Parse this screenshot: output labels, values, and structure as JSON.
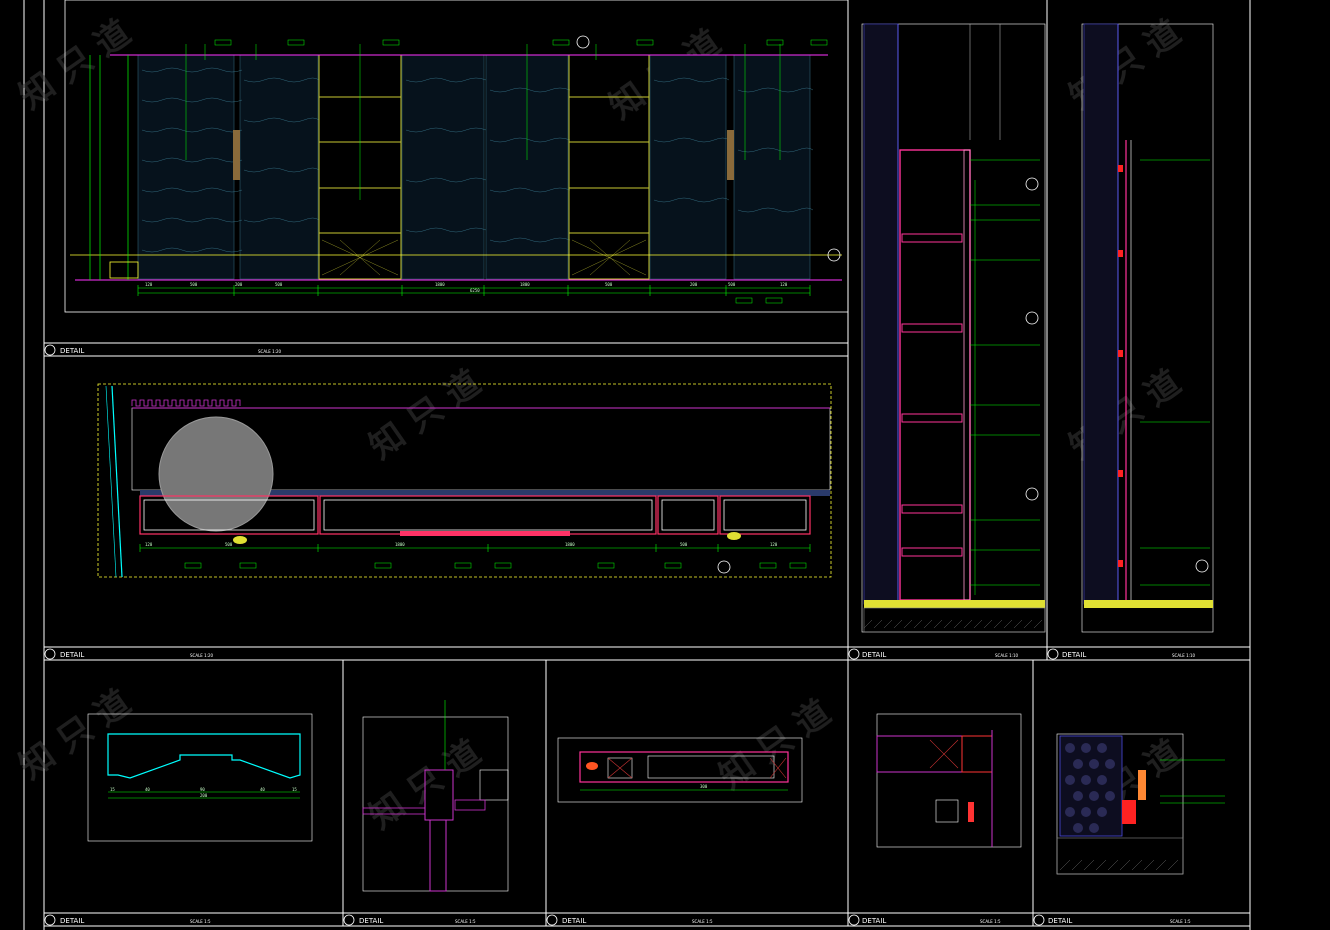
{
  "title_blocks": [
    {
      "id": "elev-main",
      "label": "DETAIL",
      "name": "",
      "scale": "SCALE 1:20"
    },
    {
      "id": "plan-main",
      "label": "DETAIL",
      "name": "",
      "scale": "SCALE 1:20"
    },
    {
      "id": "section-1",
      "label": "DETAIL",
      "name": "",
      "scale": "SCALE 1:10"
    },
    {
      "id": "section-2",
      "label": "DETAIL",
      "name": "",
      "scale": "SCALE 1:10"
    },
    {
      "id": "detail-1",
      "label": "DETAIL",
      "name": "",
      "scale": "SCALE 1:5"
    },
    {
      "id": "detail-2",
      "label": "DETAIL",
      "name": "",
      "scale": "SCALE 1:5"
    },
    {
      "id": "detail-3",
      "label": "DETAIL",
      "name": "",
      "scale": "SCALE 1:5"
    },
    {
      "id": "detail-4",
      "label": "DETAIL",
      "name": "",
      "scale": "SCALE 1:5"
    },
    {
      "id": "detail-5",
      "label": "DETAIL",
      "name": "",
      "scale": "SCALE 1:5"
    }
  ],
  "elevation_dims": [
    "120",
    "500",
    "200",
    "500",
    "1800",
    "1800",
    "500",
    "200",
    "500",
    "120"
  ],
  "elevation_total": "6250",
  "plan_dims": [
    "120",
    "500",
    "1800",
    "1800",
    "500",
    "120"
  ],
  "detail1_dims": [
    "15",
    "40",
    "90",
    "40",
    "15",
    "200"
  ],
  "detail3_dims": [
    "300"
  ],
  "colors": {
    "frame": "#ffffff",
    "dimension": "#00ff00",
    "cabinet": "#ff3399",
    "glass": "#00ffff",
    "leader": "#ffff00",
    "wall": "#5a5af0",
    "watermark": "#3a3a3a"
  }
}
